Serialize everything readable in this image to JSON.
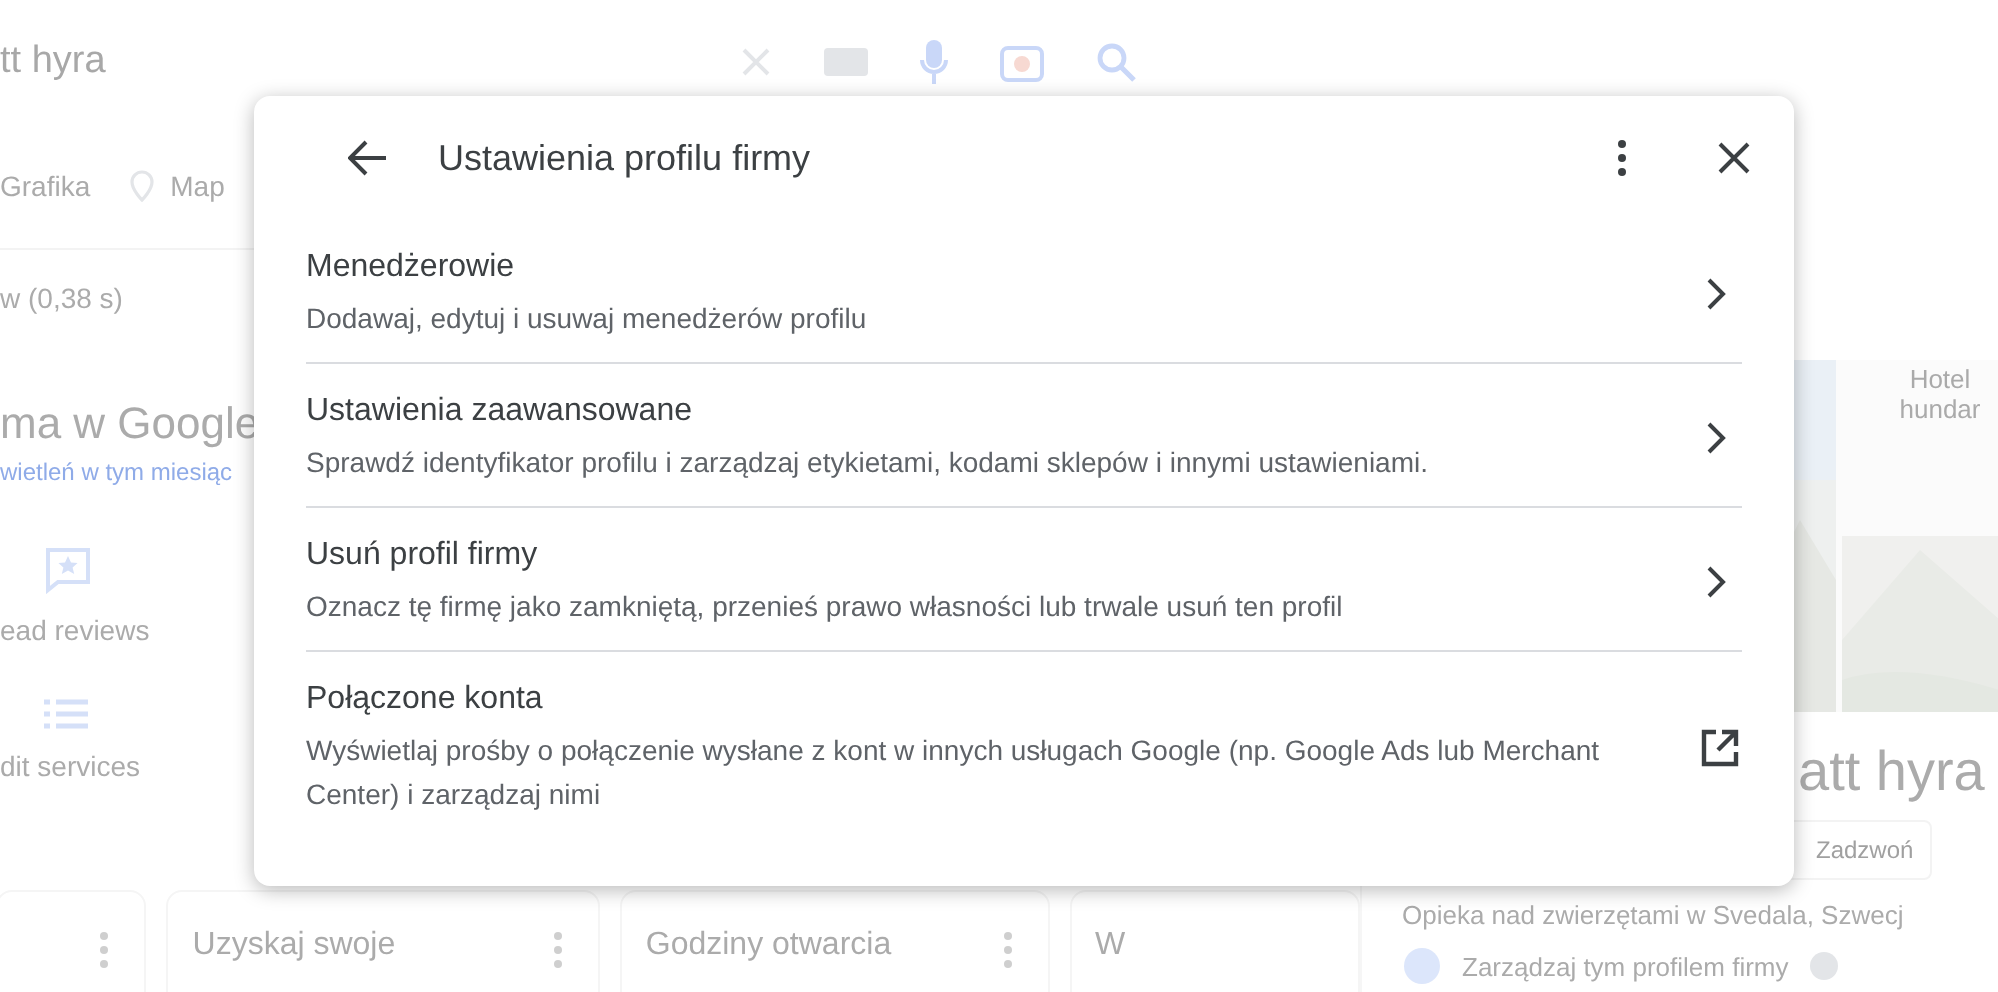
{
  "search": {
    "value": "tt hyra"
  },
  "search_tabs": [
    {
      "label": "Grafika",
      "kind": "text"
    },
    {
      "label": "Map",
      "kind": "maps"
    }
  ],
  "result_stats": "w (0,38 s)",
  "business": {
    "title": "ma w Google",
    "views": "wietleń w tym miesiąc",
    "actions": [
      {
        "label": "ead reviews",
        "kind": "reviews"
      },
      {
        "label": "dit services",
        "kind": "list"
      }
    ],
    "cards": [
      {
        "menu": true
      },
      {
        "title": "Uzyskaj swoje",
        "menu": true
      },
      {
        "title": "Godziny otwarcia",
        "menu": true
      },
      {
        "title": "W",
        "menu": false
      }
    ]
  },
  "panel": {
    "photo_label": "Hotel hundar",
    "name": "att hyra",
    "buttons": [
      "Zadzwoń"
    ],
    "category": "Opieka nad zwierzętami w Svedala, Szwecj",
    "manage": "Zarządzaj tym profilem firmy"
  },
  "dialog": {
    "title": "Ustawienia profilu firmy",
    "items": [
      {
        "title": "Menedżerowie",
        "description": "Dodawaj, edytuj i usuwaj menedżerów profilu",
        "kind": "submenu"
      },
      {
        "title": "Ustawienia zaawansowane",
        "description": "Sprawdź identyfikator profilu i zarządzaj etykietami, kodami sklepów i innymi ustawieniami.",
        "kind": "submenu"
      },
      {
        "title": "Usuń profil firmy",
        "description": "Oznacz tę firmę jako zamkniętą, przenieś prawo własności lub trwale usuń ten profil",
        "kind": "submenu"
      },
      {
        "title": "Połączone konta",
        "description": "Wyświetlaj prośby o połączenie wysłane z kont w innych usługach Google (np. Google Ads lub Merchant Center) i zarządzaj nimi",
        "kind": "external"
      }
    ]
  }
}
